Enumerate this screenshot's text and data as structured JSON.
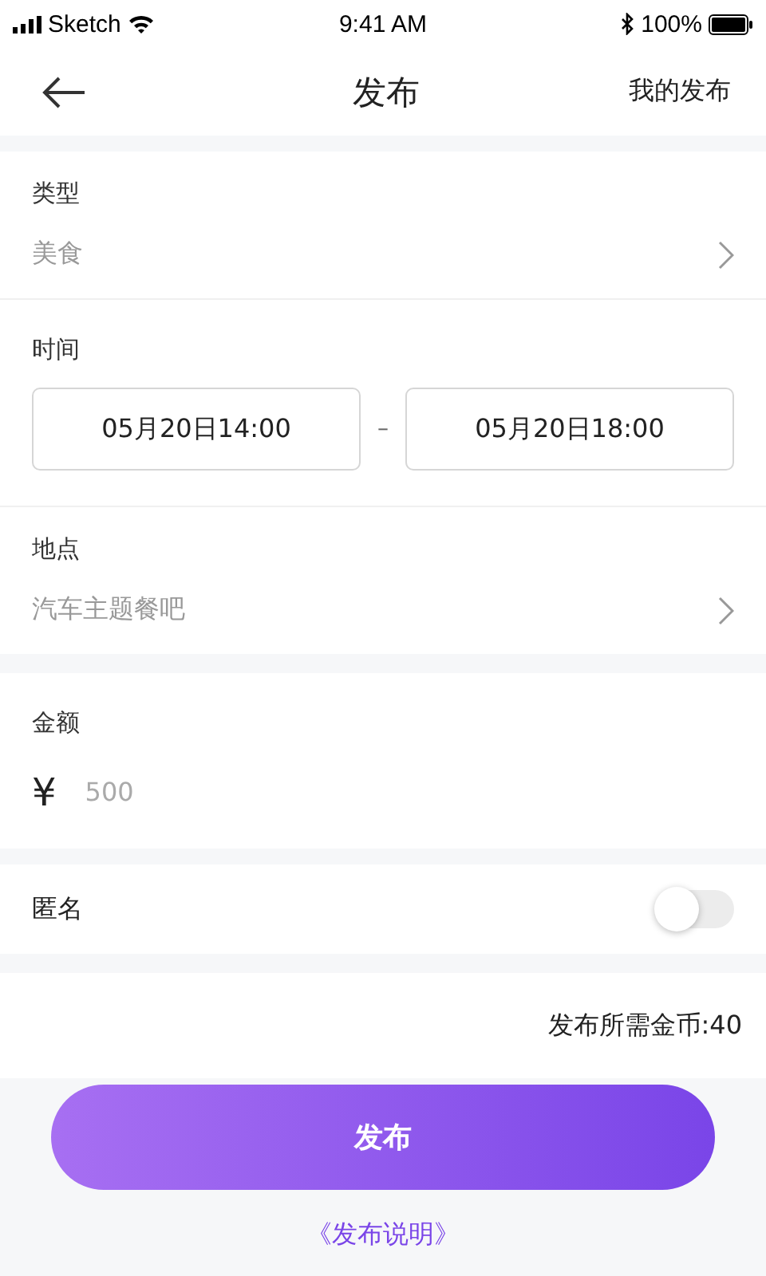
{
  "status_bar": {
    "carrier": "Sketch",
    "time": "9:41 AM",
    "battery": "100%"
  },
  "nav": {
    "title": "发布",
    "action": "我的发布"
  },
  "type": {
    "label": "类型",
    "value": "美食"
  },
  "time": {
    "label": "时间",
    "start": "05月20日14:00",
    "separator": "–",
    "end": "05月20日18:00"
  },
  "place": {
    "label": "地点",
    "value": "汽车主题餐吧"
  },
  "amount": {
    "label": "金额",
    "currency": "¥",
    "placeholder": "500"
  },
  "anonymous": {
    "label": "匿名",
    "on": false
  },
  "cost": "发布所需金币:40",
  "submit": "发布",
  "notes_link": "《发布说明》"
}
